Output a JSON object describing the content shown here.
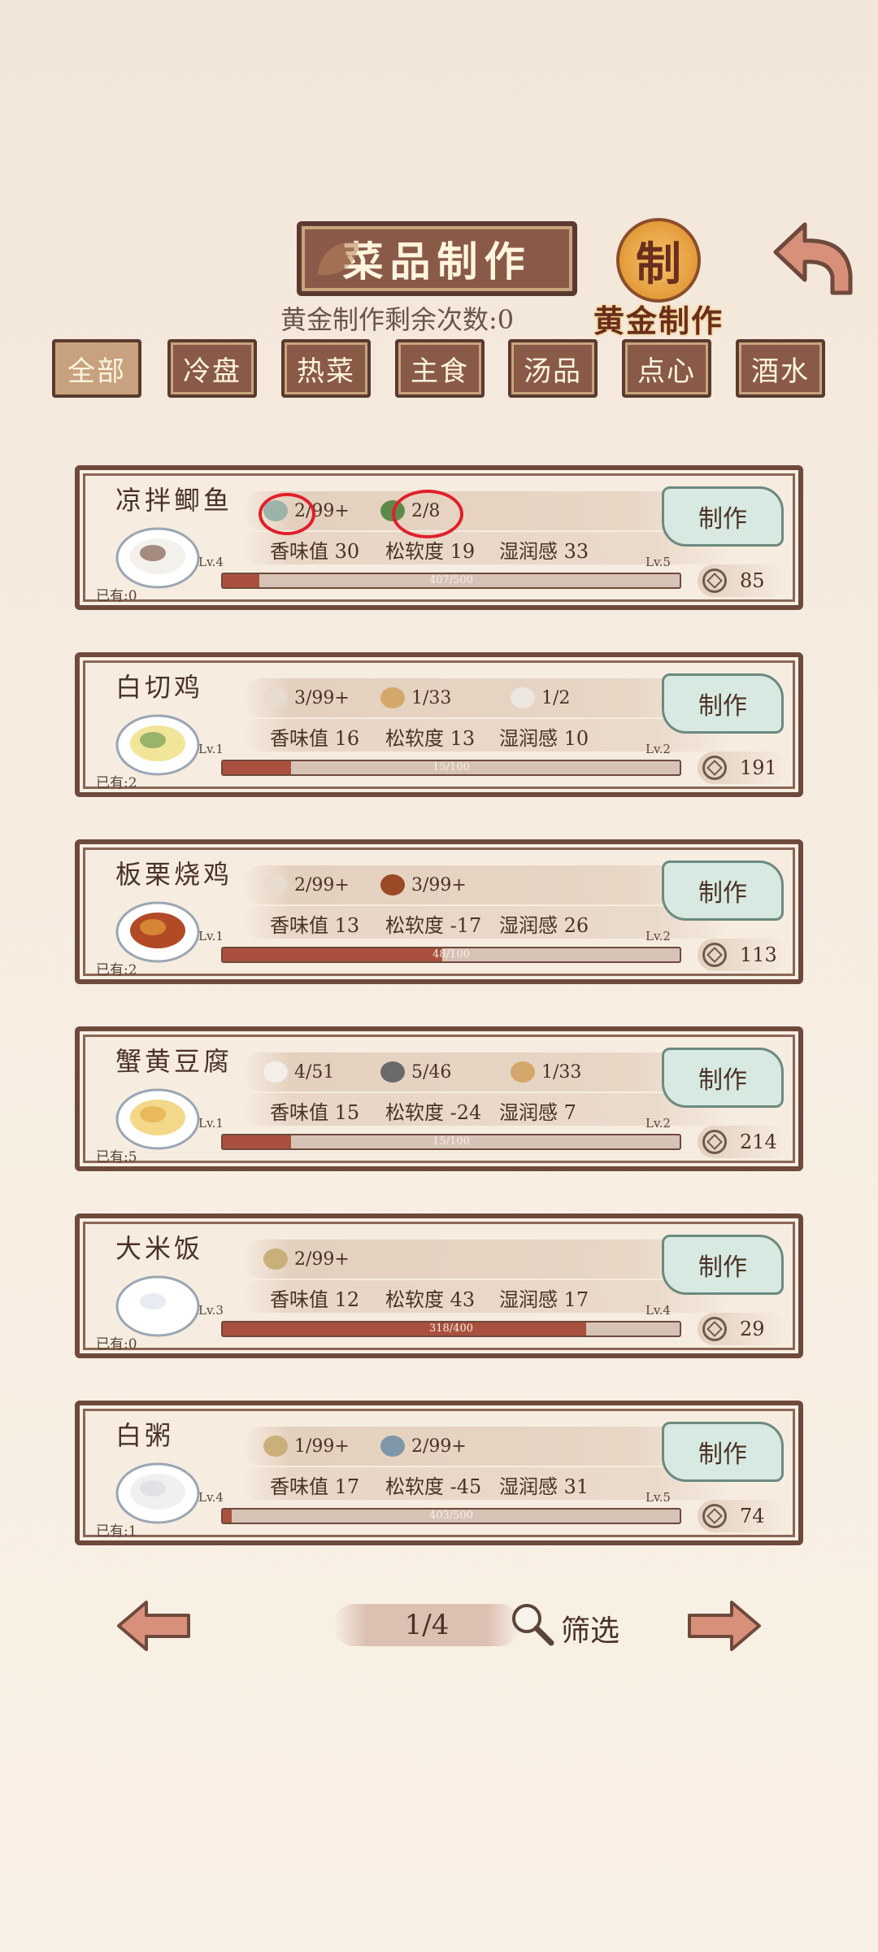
{
  "header": {
    "title": "菜品制作",
    "gold_remaining": "黄金制作剩余次数:0",
    "gold_seal_char": "制",
    "gold_label": "黄金制作"
  },
  "tabs": [
    {
      "label": "全部",
      "active": true
    },
    {
      "label": "冷盘",
      "active": false
    },
    {
      "label": "热菜",
      "active": false
    },
    {
      "label": "主食",
      "active": false
    },
    {
      "label": "汤品",
      "active": false
    },
    {
      "label": "点心",
      "active": false
    },
    {
      "label": "酒水",
      "active": false
    }
  ],
  "recipes": [
    {
      "name": "凉拌鲫鱼",
      "owned": "已有:0",
      "ingredients": [
        {
          "icon": "fish-icon",
          "color": "#9bb3a8",
          "count": "2/99+"
        },
        {
          "icon": "pepper-icon",
          "color": "#5d8a4a",
          "count": "2/8"
        }
      ],
      "stats": [
        "香味值 30",
        "松软度 19",
        "湿润感 33"
      ],
      "lv_left": "Lv.4",
      "lv_right": "Lv.5",
      "progress_text": "407/500",
      "progress": 0.08,
      "make_label": "制作",
      "price": "85",
      "dish_colors": [
        "#f4f0ec",
        "#8a6a5a"
      ]
    },
    {
      "name": "白切鸡",
      "owned": "已有:2",
      "ingredients": [
        {
          "icon": "chicken-icon",
          "color": "#e7dccd",
          "count": "3/99+"
        },
        {
          "icon": "ginger-icon",
          "color": "#d4a86a",
          "count": "1/33"
        },
        {
          "icon": "bottle-icon",
          "color": "#ece7e0",
          "count": "1/2"
        }
      ],
      "stats": [
        "香味值 16",
        "松软度 13",
        "湿润感 10"
      ],
      "lv_left": "Lv.1",
      "lv_right": "Lv.2",
      "progress_text": "15/100",
      "progress": 0.15,
      "make_label": "制作",
      "price": "191",
      "dish_colors": [
        "#f1e59a",
        "#7aa35a"
      ]
    },
    {
      "name": "板栗烧鸡",
      "owned": "已有:2",
      "ingredients": [
        {
          "icon": "chicken-icon",
          "color": "#e7dccd",
          "count": "2/99+"
        },
        {
          "icon": "chestnut-icon",
          "color": "#9a4a26",
          "count": "3/99+"
        }
      ],
      "stats": [
        "香味值 13",
        "松软度 -17",
        "湿润感 26"
      ],
      "lv_left": "Lv.1",
      "lv_right": "Lv.2",
      "progress_text": "48/100",
      "progress": 0.48,
      "make_label": "制作",
      "price": "113",
      "dish_colors": [
        "#b24a26",
        "#e09a3a"
      ]
    },
    {
      "name": "蟹黄豆腐",
      "owned": "已有:5",
      "ingredients": [
        {
          "icon": "tofu-icon",
          "color": "#f2efea",
          "count": "4/51"
        },
        {
          "icon": "crab-icon",
          "color": "#6a6a6a",
          "count": "5/46"
        },
        {
          "icon": "ginger-icon",
          "color": "#d4a86a",
          "count": "1/33"
        }
      ],
      "stats": [
        "香味值 15",
        "松软度 -24",
        "湿润感 7"
      ],
      "lv_left": "Lv.1",
      "lv_right": "Lv.2",
      "progress_text": "15/100",
      "progress": 0.15,
      "make_label": "制作",
      "price": "214",
      "dish_colors": [
        "#f3d88a",
        "#e4b04a"
      ]
    },
    {
      "name": "大米饭",
      "owned": "已有:0",
      "ingredients": [
        {
          "icon": "rice-icon",
          "color": "#c9b07a",
          "count": "2/99+"
        }
      ],
      "stats": [
        "香味值 12",
        "松软度 43",
        "湿润感 17"
      ],
      "lv_left": "Lv.3",
      "lv_right": "Lv.4",
      "progress_text": "318/400",
      "progress": 0.795,
      "make_label": "制作",
      "price": "29",
      "dish_colors": [
        "#ffffff",
        "#dfe6ee"
      ]
    },
    {
      "name": "白粥",
      "owned": "已有:1",
      "ingredients": [
        {
          "icon": "rice-icon",
          "color": "#c9b07a",
          "count": "1/99+"
        },
        {
          "icon": "water-icon",
          "color": "#7f96a8",
          "count": "2/99+"
        }
      ],
      "stats": [
        "香味值 17",
        "松软度 -45",
        "湿润感 31"
      ],
      "lv_left": "Lv.4",
      "lv_right": "Lv.5",
      "progress_text": "403/500",
      "progress": 0.02,
      "make_label": "制作",
      "price": "74",
      "dish_colors": [
        "#f2f0ee",
        "#d9dde4"
      ]
    }
  ],
  "footer": {
    "page": "1/4",
    "filter_label": "筛选"
  },
  "colors": {
    "plaque": "#8a5a48",
    "annotation": "#e0202a",
    "progress_fill": "#a9513e"
  }
}
